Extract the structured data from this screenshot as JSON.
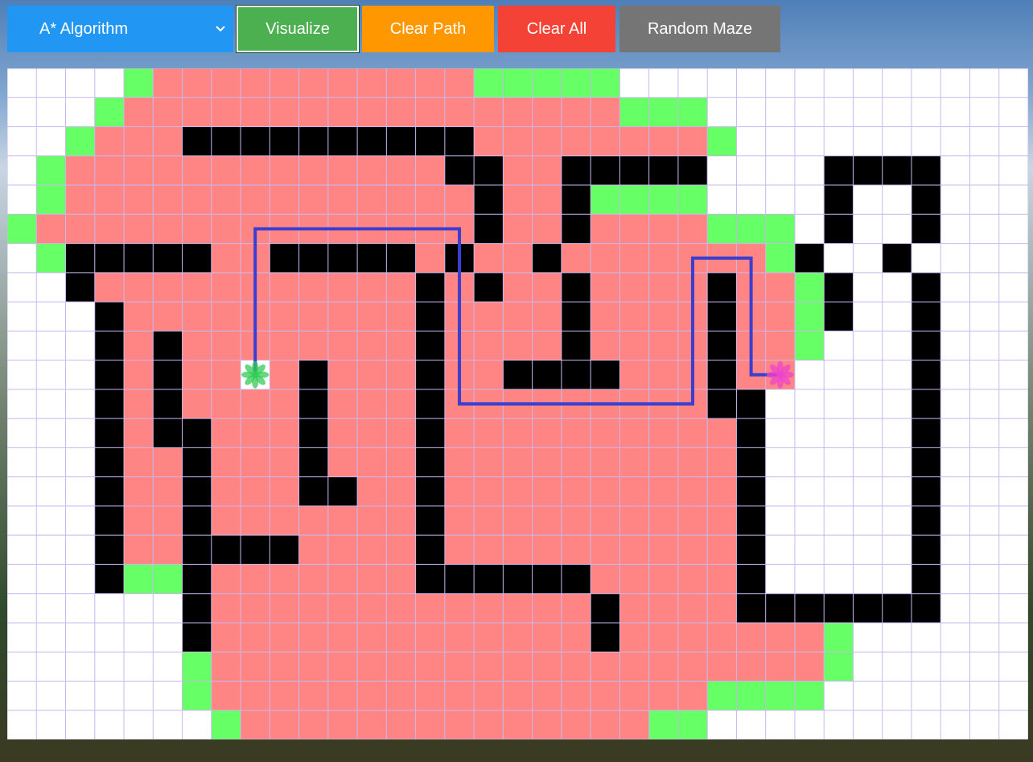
{
  "toolbar": {
    "algorithm_select": "A* Algorithm",
    "visualize_label": "Visualize",
    "clear_path_label": "Clear Path",
    "clear_all_label": "Clear All",
    "random_maze_label": "Random Maze"
  },
  "grid": {
    "cols": 35,
    "rows": 23,
    "legend": {
      ".": "empty",
      "#": "wall",
      "v": "visited",
      "o": "frontier",
      "S": "start",
      "E": "end"
    },
    "rows_data": [
      "....ovvvvvvvvvvvooooo..............",
      "...ovvvvvvvvvvvvvvvvvooo...........",
      "..ovvv##########vvvvvvvvo..........",
      ".ovvvvvvvvvvvvv##vv#####....####...",
      ".ovvvvvvvvvvvvvv#vv#oooo....#..#...",
      "ovvvvvvvvvvvvvvv#vv#vvvvooo.#..#...",
      ".o#####vv#####v#vv#vvvvvvvo#..#...",
      "..#vvvvvvvvvvv#v#vv#vvvv#vvo#..#...",
      "...#vvvvvvvvvv#vvvv#vvvv#vvo#..#...",
      "...#v#vvvvvvvv#vvvv#vvvv#vvo...#...",
      "...#v#vvSv#vvv#vv####vvv#vvE...#...",
      "...#v#vvvv#vvv#vvvvvvvvv##.....#...",
      "...#v##vvv#vvv#vvvvvvvvvv#.....#...",
      "...#vv#vvv#vvv#vvvvvvvvvv#.....#...",
      "...#vv#vvv##vv#vvvvvvvvvv#.....#...",
      "...#vv#vvvvvvv#vvvvvvvvvv#.....#...",
      "...#vv####vvvv#vvvvvvvvvv#.....#...",
      "...#oo#vvvvvvv######vvvvv#.....#...",
      "......#vvvvvvvvvvvvv#vvvv#######...",
      "......#vvvvvvvvvvvvv#vvvvvvvo......",
      "......ovvvvvvvvvvvvvvvvvvvvvo......",
      "......ovvvvvvvvvvvvvvvvvoooo.......",
      ".......ovvvvvvvvvvvvvvoo..........."
    ],
    "start": {
      "row": 10,
      "col": 8
    },
    "end": {
      "row": 10,
      "col": 26
    },
    "path_cells": [
      [
        10,
        8
      ],
      [
        9,
        8
      ],
      [
        8,
        8
      ],
      [
        7,
        8
      ],
      [
        6,
        8
      ],
      [
        5,
        8
      ],
      [
        5,
        9
      ],
      [
        5,
        10
      ],
      [
        5,
        11
      ],
      [
        5,
        12
      ],
      [
        5,
        13
      ],
      [
        5,
        14
      ],
      [
        5,
        15
      ],
      [
        6,
        15
      ],
      [
        7,
        15
      ],
      [
        8,
        15
      ],
      [
        9,
        15
      ],
      [
        10,
        15
      ],
      [
        11,
        15
      ],
      [
        11,
        16
      ],
      [
        11,
        17
      ],
      [
        11,
        18
      ],
      [
        11,
        19
      ],
      [
        11,
        20
      ],
      [
        11,
        21
      ],
      [
        11,
        22
      ],
      [
        11,
        23
      ],
      [
        10,
        23
      ],
      [
        9,
        23
      ],
      [
        8,
        23
      ],
      [
        7,
        23
      ],
      [
        6,
        23
      ],
      [
        6,
        24
      ],
      [
        6,
        25
      ],
      [
        7,
        25
      ],
      [
        8,
        25
      ],
      [
        9,
        25
      ],
      [
        10,
        25
      ],
      [
        10,
        26
      ]
    ],
    "colors": {
      "empty": "#ffffff",
      "wall": "#000000",
      "visited": "#ff8585",
      "frontier": "#66ff66",
      "gridline": "#c9b8ee",
      "path": "#3a3fd0",
      "start": "#33cc55",
      "end": "#ee44cc"
    },
    "start_icon": "flower-icon",
    "end_icon": "flower-icon"
  }
}
